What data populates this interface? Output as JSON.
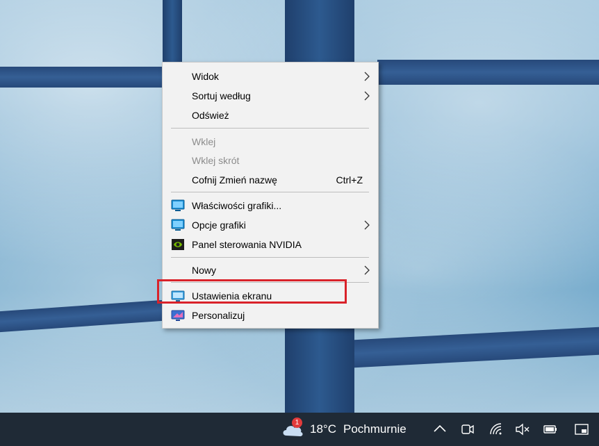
{
  "context_menu": {
    "items": [
      {
        "label": "Widok",
        "submenu": true
      },
      {
        "label": "Sortuj według",
        "submenu": true
      },
      {
        "label": "Odśwież"
      },
      {
        "label": "Wklej",
        "disabled": true
      },
      {
        "label": "Wklej skrót",
        "disabled": true
      },
      {
        "label": "Cofnij Zmień nazwę",
        "shortcut": "Ctrl+Z"
      },
      {
        "label": "Właściwości grafiki...",
        "icon": "intel-graphics-icon"
      },
      {
        "label": "Opcje grafiki",
        "icon": "intel-graphics-icon",
        "submenu": true
      },
      {
        "label": "Panel sterowania NVIDIA",
        "icon": "nvidia-icon"
      },
      {
        "label": "Nowy",
        "submenu": true
      },
      {
        "label": "Ustawienia ekranu",
        "icon": "display-settings-icon",
        "highlighted": true
      },
      {
        "label": "Personalizuj",
        "icon": "personalize-icon"
      }
    ]
  },
  "highlight_color": "#d9222a",
  "taskbar": {
    "weather": {
      "temperature": "18°C",
      "condition": "Pochmurnie",
      "badge": "1",
      "icon": "cloud-icon"
    },
    "tray_icons": [
      "chevron-up-icon",
      "meet-now-icon",
      "wifi-icon",
      "volume-muted-icon",
      "battery-icon",
      "action-center-icon"
    ]
  }
}
